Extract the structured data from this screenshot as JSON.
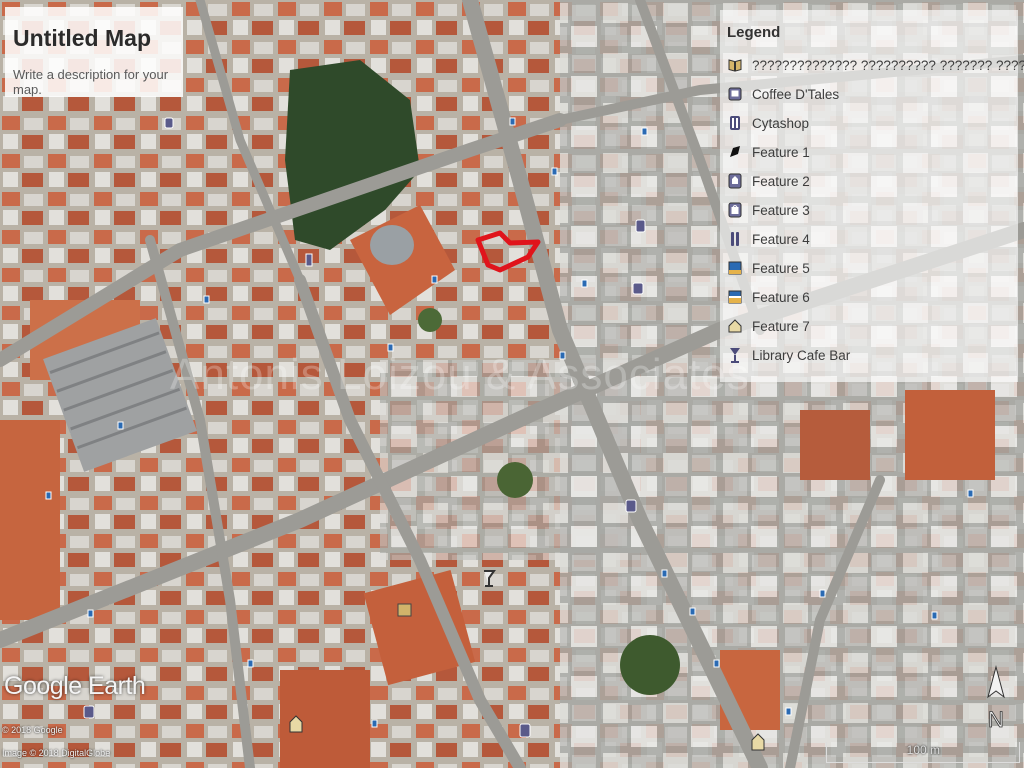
{
  "map": {
    "title": "Untitled Map",
    "description": "Write a description for your map."
  },
  "legend": {
    "title": "Legend",
    "items": [
      {
        "icon": "book-icon",
        "label": "?????????????? ?????????? ??????? ??????????"
      },
      {
        "icon": "square-icon",
        "label": "Coffee D'Tales"
      },
      {
        "icon": "pump-icon",
        "label": "Cytashop"
      },
      {
        "icon": "polygon-icon",
        "label": "Feature 1"
      },
      {
        "icon": "pin-icon",
        "label": "Feature 2"
      },
      {
        "icon": "bag-icon",
        "label": "Feature 3"
      },
      {
        "icon": "knife-fork-icon",
        "label": "Feature 4"
      },
      {
        "icon": "square-icon",
        "label": "Feature 5"
      },
      {
        "icon": "square-icon",
        "label": "Feature 6"
      },
      {
        "icon": "house-icon",
        "label": "Feature 7"
      },
      {
        "icon": "cocktail-icon",
        "label": "Library Cafe Bar"
      }
    ]
  },
  "attribution": {
    "logo": "Google Earth",
    "credit1": "© 2018 Google",
    "credit2": "Image © 2018 DigitalGlobe"
  },
  "watermark": "Antonis Loizou & Associates",
  "scale": {
    "label": "100 m"
  },
  "compass": {
    "label": "N"
  },
  "colors": {
    "highlight": "#e0141b",
    "legend_icon": "#4b4b7a"
  }
}
